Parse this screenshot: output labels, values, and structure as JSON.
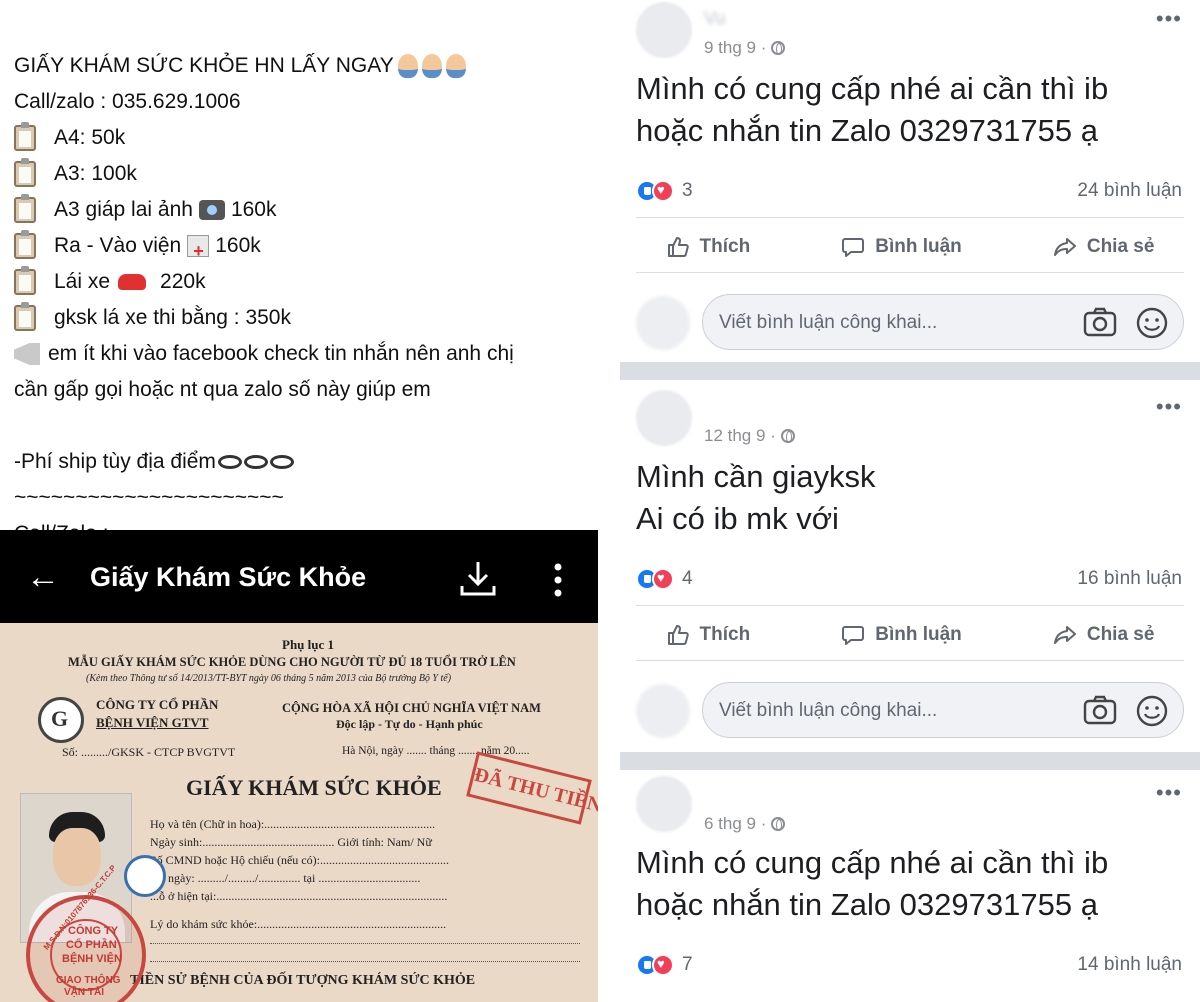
{
  "left": {
    "ad": {
      "headline": "GIẤY KHÁM SỨC KHỎE HN  LẤY NGAY",
      "contact_line": "Call/zalo : 035.629.1006",
      "prices": [
        {
          "label": "A4: 50k",
          "emoji": ""
        },
        {
          "label": "A3: 100k",
          "emoji": ""
        },
        {
          "label": "A3 giáp lai ảnh",
          "emoji": "camera-flash-icon",
          "suffix": "160k"
        },
        {
          "label": "Ra - Vào viện",
          "emoji": "hospital-icon",
          "suffix": "160k"
        },
        {
          "label": "Lái xe",
          "emoji": "car-icon",
          "suffix": "220k"
        },
        {
          "label": "gksk lá xe thi bằng  : 350k",
          "emoji": ""
        }
      ],
      "notice_line1": "em ít khi vào facebook check tin nhắn nên anh chị",
      "notice_line2": "cần gấp gọi hoặc nt qua zalo số này giúp em",
      "shipping": "-Phí ship tùy địa điểm",
      "divider": "~~~~~~~~~~~~~~~~~~~~~~",
      "contact_footer": "Call/Zalo : "
    },
    "phone": {
      "title": "Giấy Khám Sức Khỏe"
    },
    "certificate": {
      "appendix": "Phụ lục 1",
      "form_title": "MẪU GIẤY KHÁM SỨC KHỎE DÙNG CHO NGƯỜI TỪ ĐỦ 18 TUỔI TRỞ LÊN",
      "circular": "(Kèm theo Thông tư số 14/2013/TT-BYT ngày 06 tháng 5 năm 2013 của Bộ trưởng Bộ Y tế)",
      "company_line1": "CÔNG TY CỔ PHẦN",
      "company_line2": "BỆNH VIỆN GTVT",
      "nation": "CỘNG HÒA XÃ HỘI CHỦ NGHĨA VIỆT NAM",
      "motto": "Độc lập - Tự do - Hạnh phúc",
      "number": "Số: ........./GKSK - CTCP BVGTVT",
      "date_line": "Hà Nội, ngày ....... tháng ....... năm 20.....",
      "main_title": "GIẤY KHÁM SỨC KHỎE",
      "paid_stamp": "ĐÃ THU TIỀN",
      "fields": [
        "Họ và tên (Chữ in hoa):.........................................................",
        "Ngày sinh:............................................ Giới tính: Nam/ Nữ",
        "Số CMND hoặc Hộ chiếu (nếu có):...........................................",
        "...o ngày: ........./........./.............. tại ..................................",
        "...ỗ ở hiện tại:.............................................................................",
        "Lý do khám sức khỏe:..............................................................."
      ],
      "history_title": "TIỀN SỬ BỆNH CỦA ĐỐI TƯỢNG KHÁM SỨC KHỎE",
      "seal_text1": "CÔNG TY",
      "seal_text2": "CỔ PHẦN",
      "seal_text3": "BỆNH VIỆN",
      "seal_text4": "GIAO THÔNG",
      "seal_text5": "VẬN TẢI",
      "seal_code": "M.S.D.N:0107876136-C.T.C.P"
    }
  },
  "posts": [
    {
      "author": "Vu",
      "meta": "9 thg 9 ·",
      "body_line1": "Mình có cung cấp nhé ai cần thì ib",
      "body_line2": "hoặc nhắn tin Zalo 0329731755 ạ",
      "reactions": "3",
      "comments": "24 bình luận",
      "like": "Thích",
      "comment": "Bình luận",
      "share": "Chia sẻ",
      "placeholder": "Viết bình luận công khai..."
    },
    {
      "author": "",
      "meta": "12 thg 9 ·",
      "body_line1": "Mình cần giayksk",
      "body_line2": "Ai có ib mk với",
      "reactions": "4",
      "comments": "16 bình luận",
      "like": "Thích",
      "comment": "Bình luận",
      "share": "Chia sẻ",
      "placeholder": "Viết bình luận công khai..."
    },
    {
      "author": "",
      "meta": "6 thg 9 ·",
      "body_line1": "Mình có cung cấp nhé ai cần thì ib",
      "body_line2": "hoặc nhắn tin Zalo 0329731755 ạ",
      "reactions": "7",
      "comments": "14 bình luận"
    }
  ],
  "colors": {
    "fb_blue": "#1877f2",
    "love_red": "#f33e58",
    "stamp_red": "#c8483f",
    "paper": "#ead9c6"
  }
}
